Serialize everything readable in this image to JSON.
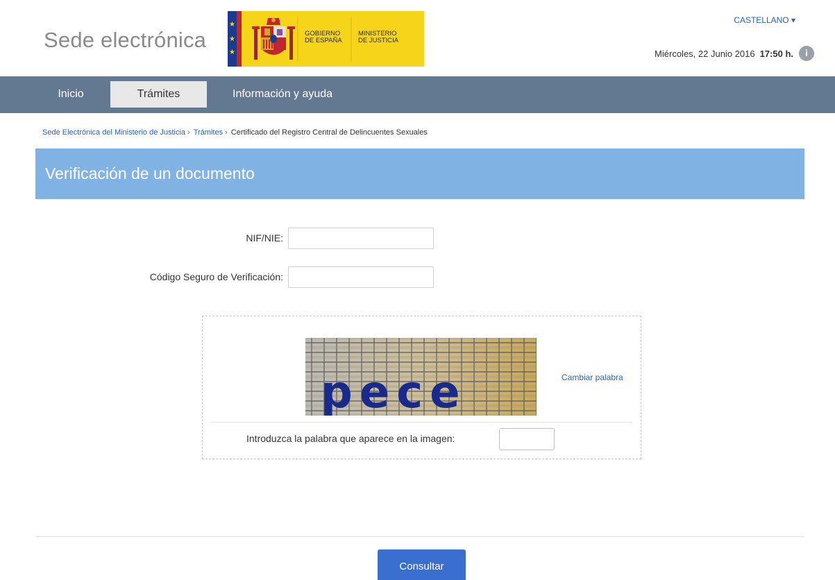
{
  "header": {
    "site_title": "Sede electrónica",
    "logo": {
      "left_text_1": "GOBIERNO",
      "left_text_2": "DE ESPAÑA",
      "right_text_1": "MINISTERIO",
      "right_text_2": "DE JUSTICIA",
      "colors": {
        "yellow": "#f5d41a",
        "red": "#c0262d",
        "blue": "#1b3b8f"
      }
    },
    "language": "CASTELLANO ▾",
    "date": "Miércoles, 22 Junio 2016",
    "time": "17:50 h.",
    "info_icon_glyph": "i"
  },
  "nav": {
    "items": [
      {
        "label": "Inicio",
        "active": false
      },
      {
        "label": "Trámites",
        "active": true
      },
      {
        "label": "Información y ayuda",
        "active": false
      }
    ]
  },
  "breadcrumb": {
    "items": [
      {
        "label": "Sede Electrónica del Ministerio de Justicia",
        "link": true
      },
      {
        "label": "Trámites",
        "link": true
      },
      {
        "label": "Certificado del Registro Central de Delincuentes Sexuales",
        "link": false
      }
    ],
    "separator": "›"
  },
  "page": {
    "title": "Verificación de un documento"
  },
  "form": {
    "nif_label": "NIF/NIE:",
    "nif_value": "",
    "csv_label": "Código Seguro de Verificación:",
    "csv_value": ""
  },
  "captcha": {
    "word": "pece",
    "change_label": "Cambiar palabra",
    "prompt_label": "Introduzca la palabra que aparece en la imagen:",
    "input_value": ""
  },
  "actions": {
    "submit_label": "Consultar"
  },
  "colors": {
    "nav_bg": "#637891",
    "title_band": "#80b2e3",
    "link": "#2a62b8",
    "button": "#3a6fd0"
  }
}
